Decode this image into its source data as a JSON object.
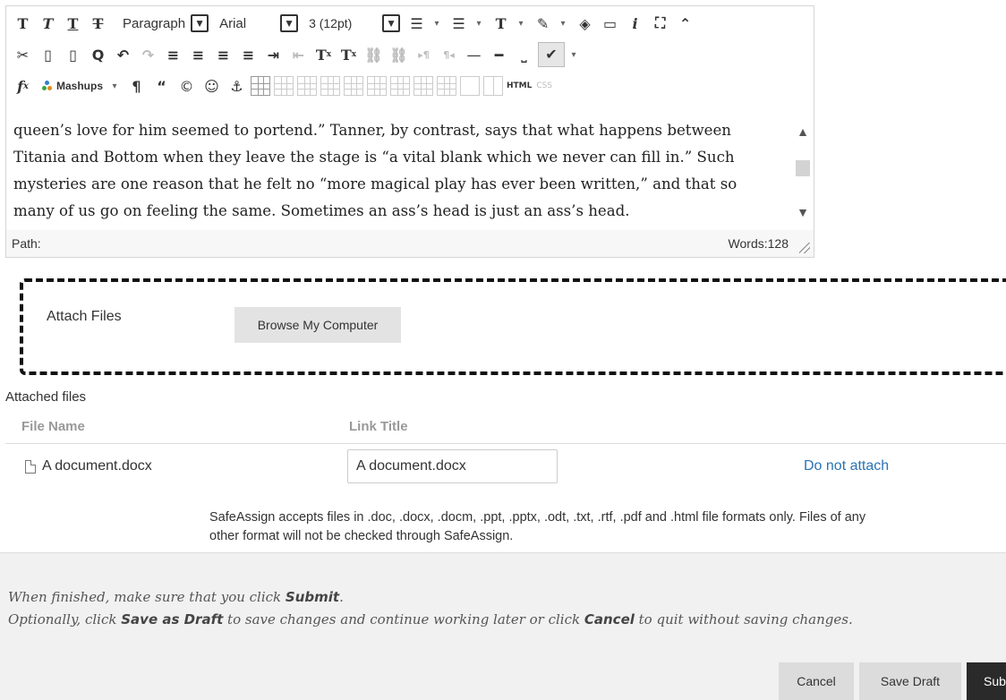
{
  "toolbar": {
    "block_format": "Paragraph",
    "font_family": "Arial",
    "font_size": "3 (12pt)",
    "mashups_label": "Mashups",
    "html_label": "HTML",
    "css_label": "CSS"
  },
  "editor": {
    "lines": [
      "queen’s love for him seemed to portend.” Tanner, by contrast, says that what happens between",
      "Titania and Bottom when they leave the stage is “a vital blank which we never can fill in.” Such",
      "mysteries are one reason that he felt no “more magical play has ever been written,” and that so",
      "many of us go on feeling the same. Sometimes an ass’s head is just an ass’s head."
    ],
    "path_label": "Path:",
    "word_count": "Words:128"
  },
  "attach": {
    "label": "Attach Files",
    "browse_button": "Browse My Computer"
  },
  "attached_files": {
    "title": "Attached files",
    "col_file_name": "File Name",
    "col_link_title": "Link Title",
    "rows": [
      {
        "file_name": "A document.docx",
        "link_title": "A document.docx",
        "action": "Do not attach"
      }
    ],
    "safeassign_note_line1": "SafeAssign accepts files in .doc, .docx, .docm, .ppt, .pptx, .odt, .txt, .rtf, .pdf and .html file formats only. Files of any",
    "safeassign_note_line2": "other format will not be checked through SafeAssign."
  },
  "footer": {
    "line1_pre": "When finished, make sure that you click ",
    "line1_bold": "Submit",
    "line1_post": ".",
    "line2_pre": "Optionally, click ",
    "line2_bold1": "Save as Draft",
    "line2_mid": " to save changes and continue working later or click ",
    "line2_bold2": "Cancel",
    "line2_post": " to quit without saving changes.",
    "cancel_button": "Cancel",
    "save_draft_button": "Save Draft",
    "submit_button": "Submit"
  },
  "colors": {
    "link": "#2a74b5",
    "submit_bg": "#2a2a2a",
    "footer_bg": "#f1f1f1"
  }
}
